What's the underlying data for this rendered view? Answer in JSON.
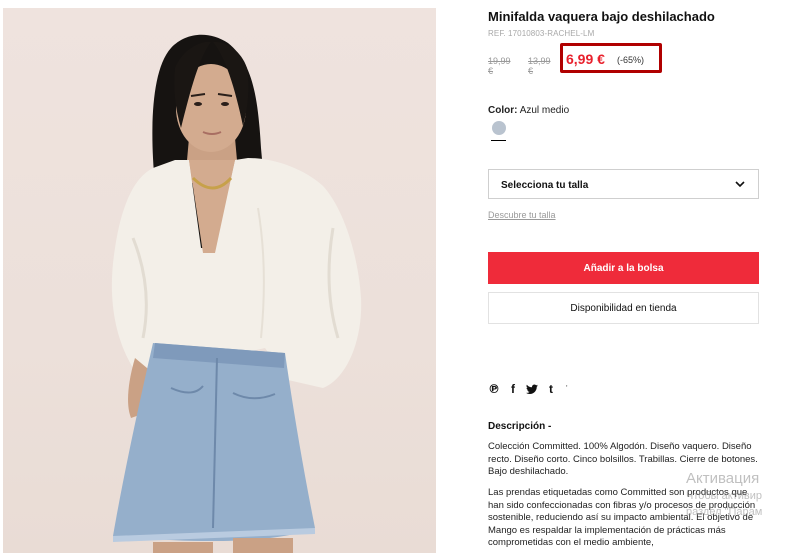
{
  "product": {
    "title": "Minifalda vaquera bajo deshilachado",
    "ref": "REF. 17010803-RACHEL-LM",
    "prices": {
      "original": "19,99 €",
      "previous": "13,99 €",
      "current": "6,99 €",
      "discount": "(-65%)"
    },
    "color": {
      "label": "Color:",
      "value": "Azul medio",
      "swatch_hex": "#b9c3cf"
    },
    "size_select_label": "Selecciona tu talla",
    "size_guide_link": "Descubre tu talla",
    "add_to_bag": "Añadir a la bolsa",
    "store_availability": "Disponibilidad en tienda"
  },
  "share_icons": [
    "pinterest-icon",
    "facebook-icon",
    "twitter-icon",
    "tumblr-icon",
    "more-icon"
  ],
  "description": {
    "title": "Descripción -",
    "paragraph1": "Colección Committed. 100% Algodón. Diseño vaquero. Diseño recto. Diseño corto. Cinco bolsillos. Trabillas. Cierre de botones. Bajo deshilachado.",
    "paragraph2": "Las prendas etiquetadas como Committed son productos que han sido confeccionadas con fibras y/o procesos de producción sostenible, reduciendo así su impacto ambiental. El objetivo de Mango es respaldar la implementación de prácticas más comprometidas con el medio ambiente,"
  },
  "os_watermark": {
    "line1": "Активация",
    "line2": "Чтобы активир",
    "line3": "раздел \"Парам"
  },
  "colors": {
    "accent_red": "#ef2b3a",
    "price_red": "#e8202c",
    "highlight_box": "#b00000"
  }
}
